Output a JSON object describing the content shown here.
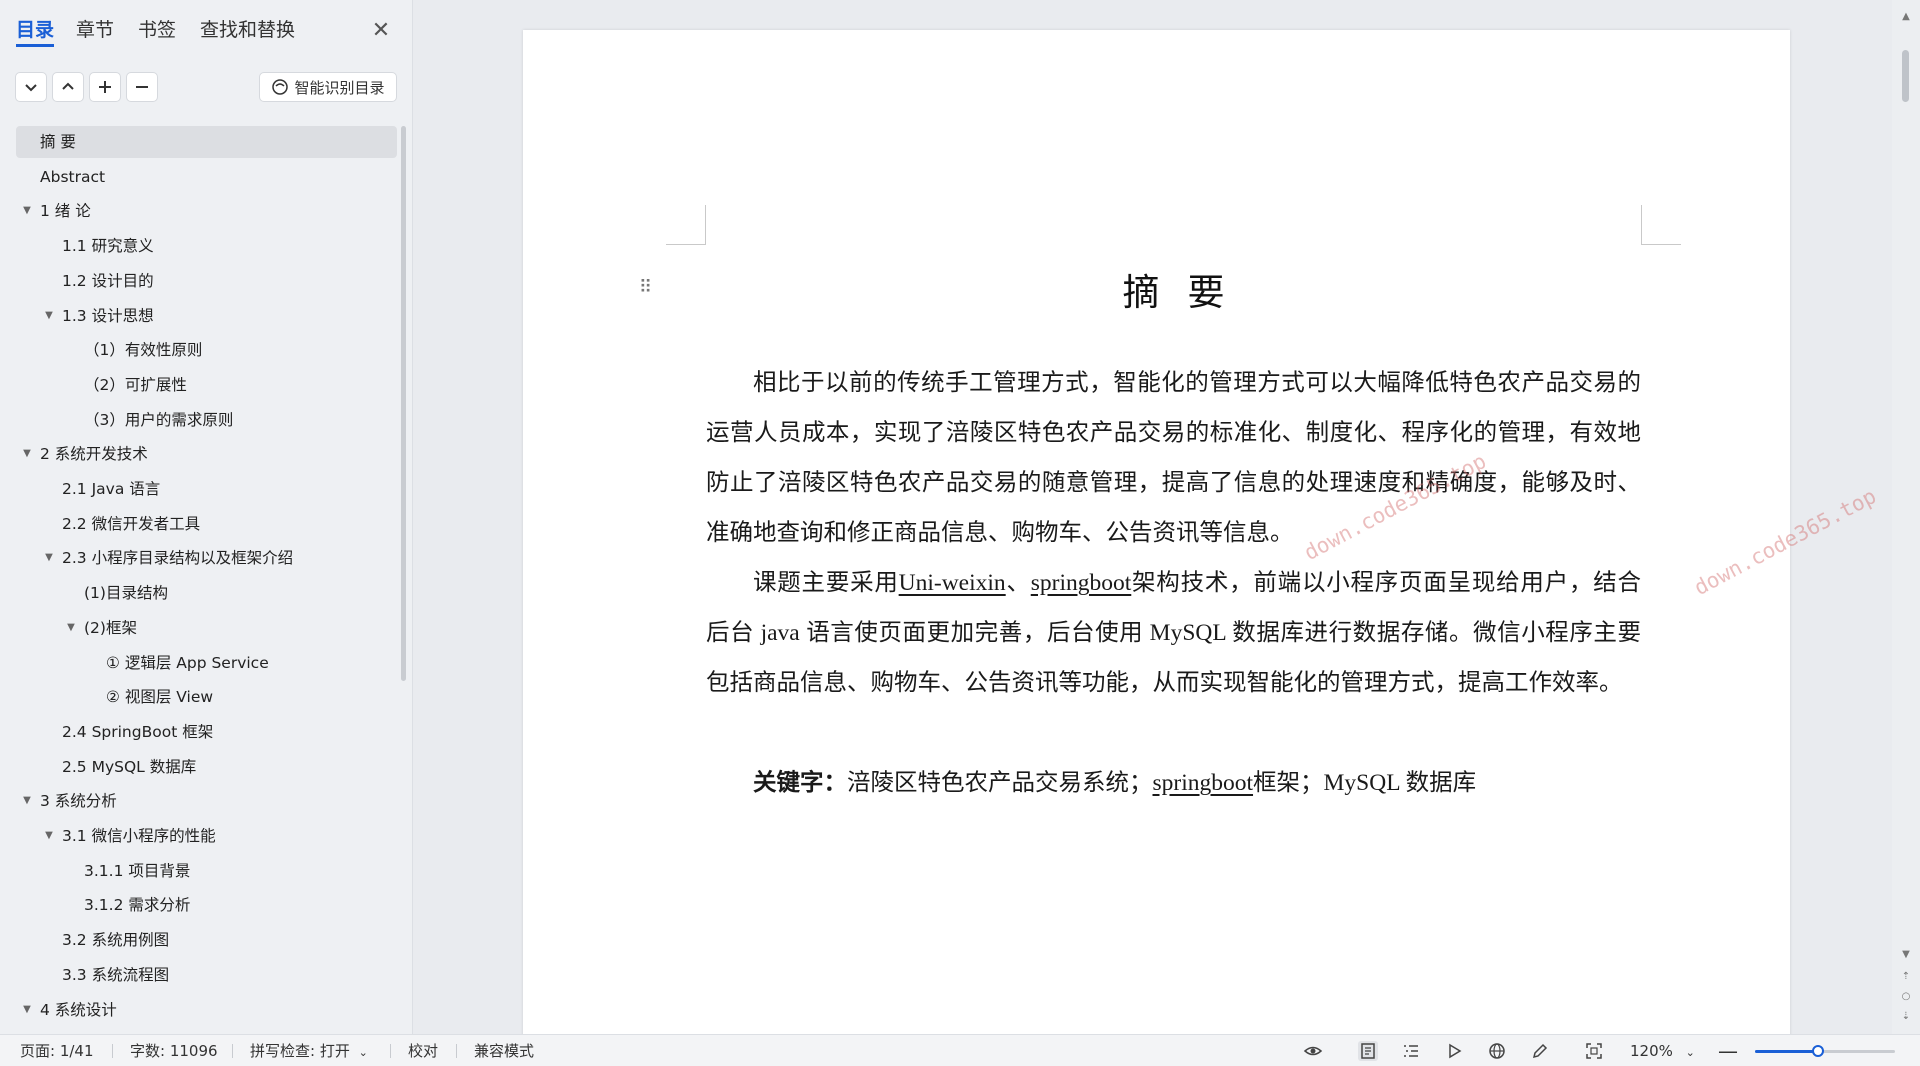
{
  "sidebar": {
    "tabs": [
      {
        "label": "目录",
        "active": true
      },
      {
        "label": "章节",
        "active": false
      },
      {
        "label": "书签",
        "active": false
      },
      {
        "label": "查找和替换",
        "active": false
      }
    ],
    "close_glyph": "✕",
    "smart_toc_label": "智能识别目录",
    "toc": [
      {
        "label": "摘  要",
        "level": 0,
        "caret": "",
        "selected": true
      },
      {
        "label": "Abstract",
        "level": 0,
        "caret": ""
      },
      {
        "label": "1 绪  论",
        "level": 0,
        "caret": "▼"
      },
      {
        "label": "1.1 研究意义",
        "level": 1,
        "caret": ""
      },
      {
        "label": "1.2 设计目的",
        "level": 1,
        "caret": ""
      },
      {
        "label": "1.3 设计思想",
        "level": 1,
        "caret": "▼"
      },
      {
        "label": "（1）有效性原则",
        "level": 2,
        "caret": ""
      },
      {
        "label": "（2）可扩展性",
        "level": 2,
        "caret": ""
      },
      {
        "label": "（3）用户的需求原则",
        "level": 2,
        "caret": ""
      },
      {
        "label": "2 系统开发技术",
        "level": 0,
        "caret": "▼"
      },
      {
        "label": "2.1 Java 语言",
        "level": 1,
        "caret": ""
      },
      {
        "label": "2.2 微信开发者工具",
        "level": 1,
        "caret": ""
      },
      {
        "label": "2.3 小程序目录结构以及框架介绍",
        "level": 1,
        "caret": "▼"
      },
      {
        "label": "(1)目录结构",
        "level": 2,
        "caret": ""
      },
      {
        "label": "(2)框架",
        "level": 2,
        "caret": "▼"
      },
      {
        "label": "①  逻辑层 App Service",
        "level": 3,
        "caret": ""
      },
      {
        "label": "②  视图层 View",
        "level": 3,
        "caret": ""
      },
      {
        "label": "2.4 SpringBoot 框架",
        "level": 1,
        "caret": ""
      },
      {
        "label": "2.5 MySQL 数据库",
        "level": 1,
        "caret": ""
      },
      {
        "label": "3 系统分析",
        "level": 0,
        "caret": "▼"
      },
      {
        "label": "3.1 微信小程序的性能",
        "level": 1,
        "caret": "▼"
      },
      {
        "label": "3.1.1 项目背景",
        "level": 2,
        "caret": ""
      },
      {
        "label": "3.1.2 需求分析",
        "level": 2,
        "caret": ""
      },
      {
        "label": "3.2 系统用例图",
        "level": 1,
        "caret": ""
      },
      {
        "label": "3.3  系统流程图",
        "level": 1,
        "caret": ""
      },
      {
        "label": "4 系统设计",
        "level": 0,
        "caret": "▼"
      }
    ]
  },
  "document": {
    "title": "摘要",
    "para1": "相比于以前的传统手工管理方式，智能化的管理方式可以大幅降低特色农产品交易的运营人员成本，实现了涪陵区特色农产品交易的标准化、制度化、程序化的管理，有效地防止了涪陵区特色农产品交易的随意管理，提高了信息的处理速度和精确度，能够及时、准确地查询和修正商品信息、购物车、公告资讯等信息。",
    "para2": {
      "p1": "课题主要采用",
      "u1": "Uni-weixin",
      "p2": "、",
      "u2": "springboot",
      "p3": "架构技术，前端以小程序页面呈现给用户，结合后台 java 语言使页面更加完善，后台使用 MySQL 数据库进行数据存储。微信小程序主要包括商品信息、购物车、公告资讯等功能，从而实现智能化的管理方式，提高工作效率。"
    },
    "para3": {
      "label": "关键字：",
      "p1": "涪陵区特色农产品交易系统；",
      "u1": "springboot",
      "p2": "框架；MySQL 数据库"
    },
    "watermark": "down.code365.top"
  },
  "statusbar": {
    "page": "页面: 1/41",
    "word_count": "字数: 11096",
    "spell_check": "拼写检查: 打开",
    "proofread": "校对",
    "compat_mode": "兼容模式",
    "zoom": "120%",
    "zoom_fraction": 0.45,
    "accent": "#1a5fd6"
  }
}
